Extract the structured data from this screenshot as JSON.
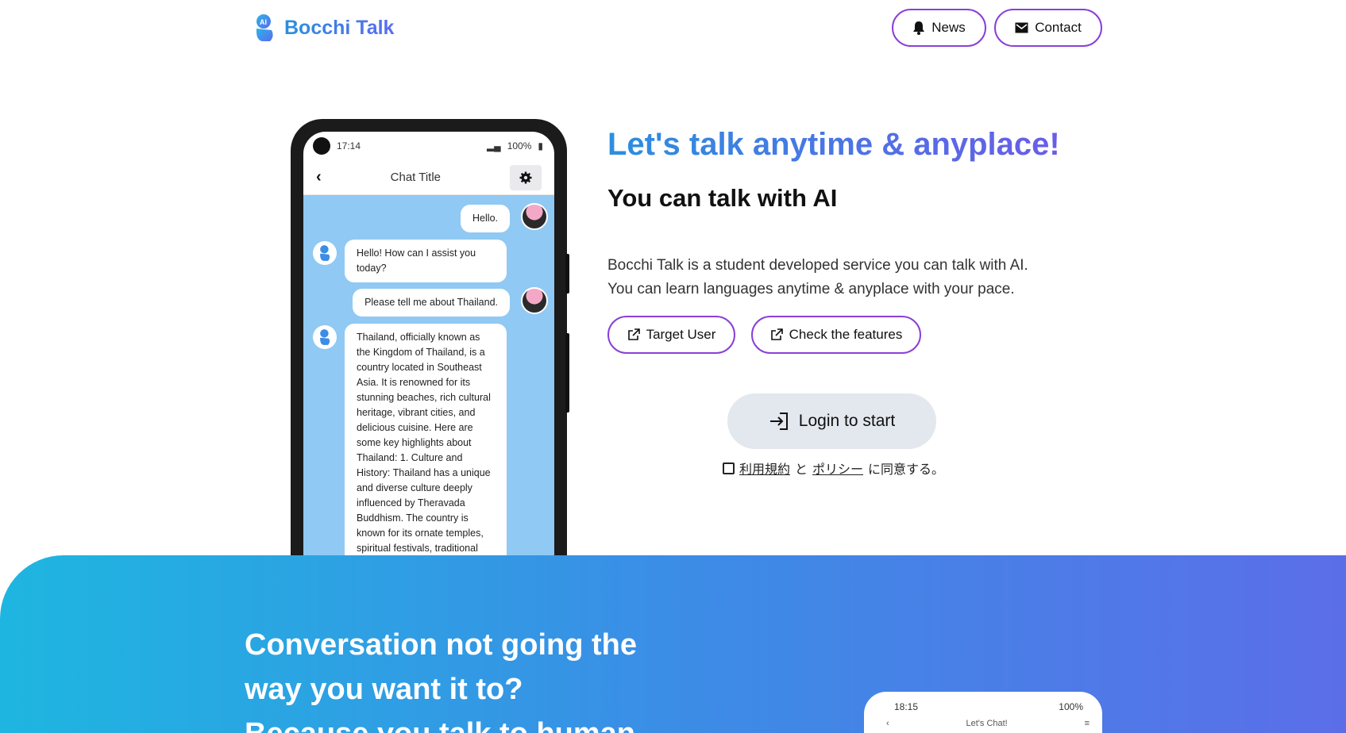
{
  "header": {
    "brand": "Bocchi Talk",
    "nav": [
      {
        "label": "News",
        "icon": "bell-icon"
      },
      {
        "label": "Contact",
        "icon": "envelope-icon"
      }
    ]
  },
  "phone": {
    "status_time": "17:14",
    "status_battery": "100%",
    "chat_title": "Chat Title",
    "messages": [
      {
        "from": "user",
        "text": "Hello."
      },
      {
        "from": "ai",
        "text": "Hello! How can I assist you today?"
      },
      {
        "from": "user",
        "text": "Please tell me about Thailand."
      },
      {
        "from": "ai",
        "text": "Thailand, officially known as the Kingdom of Thailand, is a country located in Southeast Asia. It is renowned for its stunning beaches, rich cultural heritage, vibrant cities, and delicious cuisine. Here are some key highlights about Thailand: 1. Culture and History: Thailand has a unique and diverse culture deeply influenced by Theravada Buddhism. The country is known for its ornate temples, spiritual festivals, traditional music and"
      }
    ]
  },
  "hero": {
    "title": "Let's talk anytime & anyplace!",
    "subtitle": "You can talk with AI",
    "desc_line1": "Bocchi Talk is a student developed service you can talk with AI.",
    "desc_line2": "You can learn languages anytime & anyplace with your pace.",
    "target_user": "Target User",
    "check_features": "Check the features",
    "login": "Login to start",
    "agree_terms": "利用規約",
    "agree_and": "と",
    "agree_policy": "ポリシー",
    "agree_suffix": "に同意する。"
  },
  "section2": {
    "title_line1": "Conversation not going the",
    "title_line2": "way you want it to?",
    "title_line3": "Because you talk to human",
    "phone_time": "18:15",
    "phone_battery": "100%",
    "phone_chat_title": "Let's Chat!"
  },
  "colors": {
    "accent_purple": "#8a3fd8",
    "brand_blue": "#2b8fe0",
    "chat_bg": "#90c9f3"
  }
}
